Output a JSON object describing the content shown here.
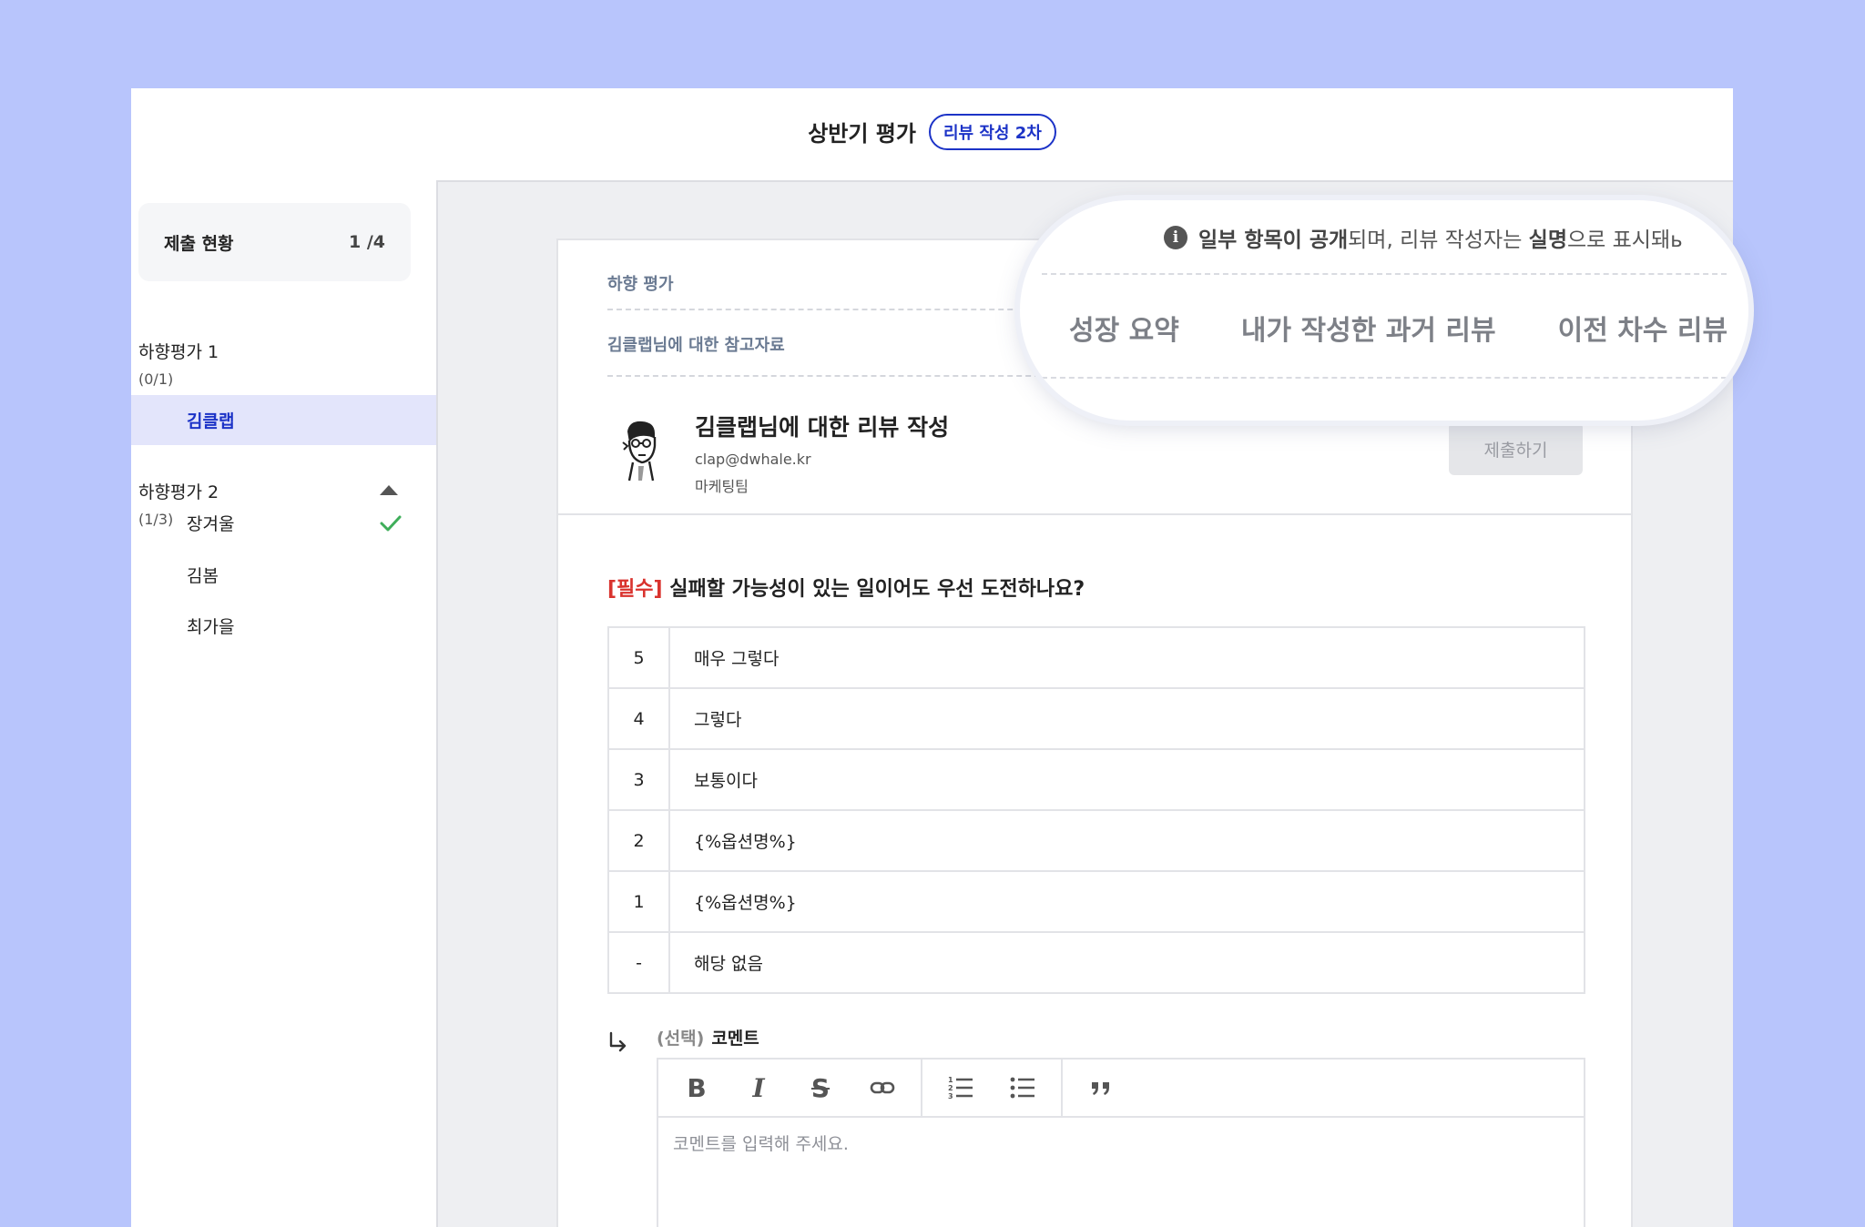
{
  "header": {
    "title": "상반기 평가",
    "badge": "리뷰 작성 2차"
  },
  "sidebar": {
    "status": {
      "label": "제출 현황",
      "count": "1 /4"
    },
    "groups": [
      {
        "title": "하향평가 1",
        "progress": "(0/1)",
        "members": [
          "김클랩"
        ]
      },
      {
        "title": "하향평가 2",
        "progress": "(1/3)",
        "members": [
          "장겨울",
          "김봄",
          "최가을"
        ]
      }
    ]
  },
  "card": {
    "section_label": "하향 평가",
    "reference_label": "김클랩님에 대한 참고자료",
    "reviewee": {
      "title": "김클랩님에 대한 리뷰 작성",
      "email": "clap@dwhale.kr",
      "team": "마케팅팀"
    },
    "submit_label": "제출하기",
    "question": {
      "required_tag": "[필수]",
      "text": " 실패할 가능성이 있는 일이어도 우선 도전하나요?"
    },
    "options": [
      {
        "num": "5",
        "label": "매우 그렇다"
      },
      {
        "num": "4",
        "label": "그렇다"
      },
      {
        "num": "3",
        "label": "보통이다"
      },
      {
        "num": "2",
        "label": "{%옵션명%}"
      },
      {
        "num": "1",
        "label": "{%옵션명%}"
      },
      {
        "num": "-",
        "label": "해당 없음"
      }
    ],
    "comment": {
      "optional": "(선택)",
      "label": "코멘트",
      "placeholder": "코멘트를 입력해 주세요."
    },
    "toolbar_tools": [
      "bold-icon",
      "italic-icon",
      "strikethrough-icon",
      "link-icon",
      "ordered-list-icon",
      "bullet-list-icon",
      "quote-icon"
    ]
  },
  "callout": {
    "notice_bold1": "일부 항목이 공개",
    "notice_mid": "되며, 리뷰 작성자는 ",
    "notice_bold2": "실명",
    "notice_end": "으로 표시돼ь",
    "tabs": [
      "성장 요약",
      "내가 작성한 과거 리뷰",
      "이전 차수 리뷰"
    ]
  },
  "colors": {
    "accent": "#1c33c7",
    "required": "#d9332e",
    "background": "#b8c5fc",
    "check": "#3fae5a"
  }
}
